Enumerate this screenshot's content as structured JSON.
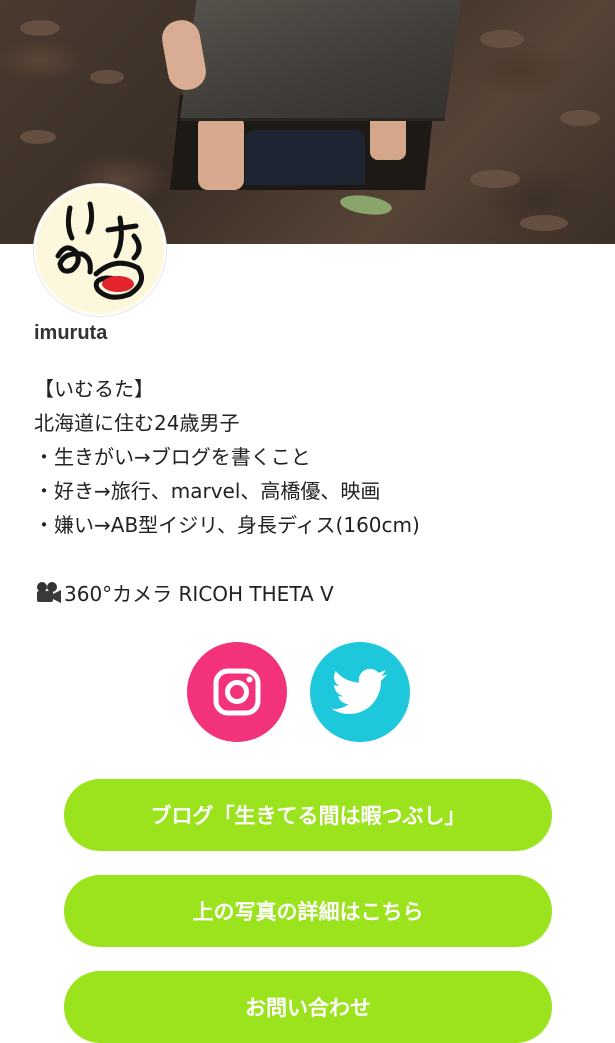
{
  "profile": {
    "username": "imuruta",
    "bio_lines": [
      "【いむるた】",
      "北海道に住む24歳男子",
      "・生きがい→ブログを書くこと",
      "・好き→旅行、marvel、高橋優、映画",
      "・嫌い→AB型イジリ、身長ディス(160cm)"
    ],
    "camera_line": "360°カメラ RICOH THETA V"
  },
  "social": {
    "instagram_color": "#f2337c",
    "twitter_color": "#1ec8dc"
  },
  "buttons": [
    {
      "label": "ブログ「生きてる間は暇つぶし」"
    },
    {
      "label": "上の写真の詳細はこちら"
    },
    {
      "label": "お問い合わせ"
    }
  ],
  "colors": {
    "button_bg": "#9be31d",
    "button_text": "#ffffff"
  },
  "icons": [
    "instagram-icon",
    "twitter-icon",
    "movie-camera-icon"
  ]
}
